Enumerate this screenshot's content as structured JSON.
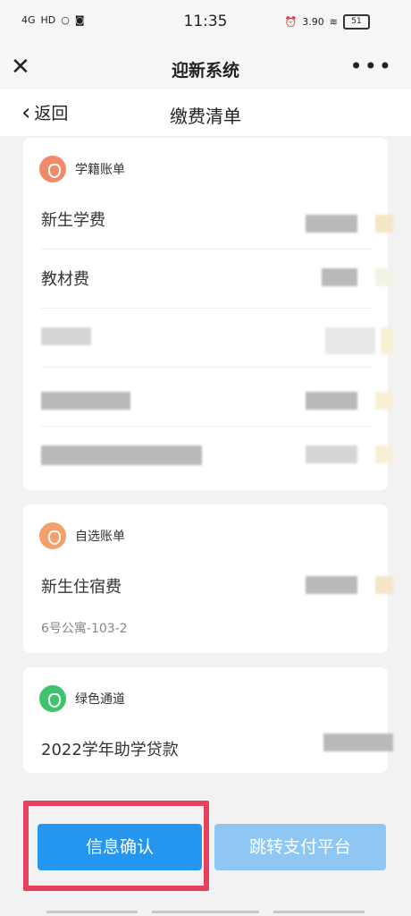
{
  "status_bar": {
    "left": [
      "4G",
      "HD"
    ],
    "time": "11:35",
    "speed": "3.90",
    "battery": "51"
  },
  "app_bar": {
    "close_icon": "close-icon",
    "title": "迎新系统",
    "more_icon": "more-icon",
    "more_glyph": "•••"
  },
  "nav": {
    "back_label": "返回",
    "title": "缴费清单"
  },
  "cards": [
    {
      "title": "学籍账单",
      "rows": [
        {
          "label": "新生学费"
        },
        {
          "label": "教材费"
        },
        {
          "label": ""
        },
        {
          "label": ""
        },
        {
          "label": ""
        }
      ]
    },
    {
      "title": "自选账单",
      "rows": [
        {
          "label": "新生住宿费"
        }
      ],
      "subtext": "6号公寓-103-2"
    },
    {
      "title": "绿色通道",
      "rows": [
        {
          "label": "2022学年助学贷款"
        }
      ]
    }
  ],
  "buttons": {
    "confirm": "信息确认",
    "pay": "跳转支付平台"
  },
  "colors": {
    "primary": "#2596f0",
    "primary_disabled": "#8ec6f4",
    "highlight": "#e7405f",
    "badge_orange": "#f08a67",
    "badge_green": "#3dc46c"
  }
}
